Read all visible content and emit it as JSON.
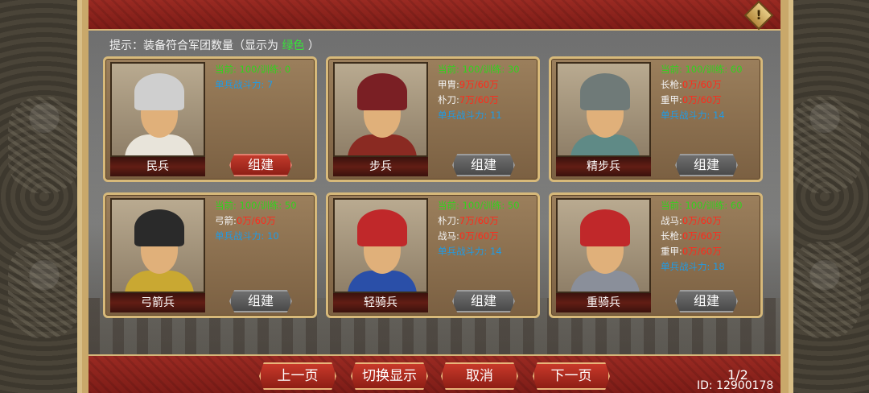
{
  "hint": {
    "prefix": "提示：装备符合军团数量（显示为",
    "green_word": "绿色",
    "suffix": "）"
  },
  "units": [
    {
      "name": "民兵",
      "stats": [
        {
          "text": "当前: 100/训练: 0",
          "color": "green"
        },
        {
          "text": "单兵战斗力: 7",
          "color": "blue"
        }
      ],
      "build_label": "组建",
      "build_active": true,
      "helm_color": "#cfcfcf",
      "body_color": "#e8e4da"
    },
    {
      "name": "步兵",
      "stats": [
        {
          "text": "当前: 100/训练: 30",
          "color": "green"
        },
        {
          "label": "甲胄:",
          "value": "9万/60万"
        },
        {
          "label": "朴刀:",
          "value": "7万/60万"
        },
        {
          "text": "单兵战斗力: 11",
          "color": "blue"
        }
      ],
      "build_label": "组建",
      "build_active": false,
      "helm_color": "#7a1f24",
      "body_color": "#8a2a22"
    },
    {
      "name": "精步兵",
      "stats": [
        {
          "text": "当前: 100/训练: 60",
          "color": "green"
        },
        {
          "label": "长枪:",
          "value": "0万/60万"
        },
        {
          "label": "重甲:",
          "value": "0万/60万"
        },
        {
          "text": "单兵战斗力: 14",
          "color": "blue"
        }
      ],
      "build_label": "组建",
      "build_active": false,
      "helm_color": "#6f7a78",
      "body_color": "#5f8a86"
    },
    {
      "name": "弓箭兵",
      "stats": [
        {
          "text": "当前: 100/训练: 50",
          "color": "green"
        },
        {
          "label": "弓箭:",
          "value": "0万/60万"
        },
        {
          "text": "单兵战斗力: 10",
          "color": "blue"
        }
      ],
      "build_label": "组建",
      "build_active": false,
      "helm_color": "#2a2a2a",
      "body_color": "#c9a832"
    },
    {
      "name": "轻骑兵",
      "stats": [
        {
          "text": "当前: 100/训练: 50",
          "color": "green"
        },
        {
          "label": "朴刀:",
          "value": "7万/60万"
        },
        {
          "label": "战马:",
          "value": "0万/60万"
        },
        {
          "text": "单兵战斗力: 14",
          "color": "blue"
        }
      ],
      "build_label": "组建",
      "build_active": false,
      "helm_color": "#c0282a",
      "body_color": "#2a4fa8"
    },
    {
      "name": "重骑兵",
      "stats": [
        {
          "text": "当前: 100/训练: 60",
          "color": "green"
        },
        {
          "label": "战马:",
          "value": "0万/60万"
        },
        {
          "label": "长枪:",
          "value": "0万/60万"
        },
        {
          "label": "重甲:",
          "value": "0万/60万"
        },
        {
          "text": "单兵战斗力: 18",
          "color": "blue"
        }
      ],
      "build_label": "组建",
      "build_active": false,
      "helm_color": "#c0282a",
      "body_color": "#8a8f9a"
    }
  ],
  "nav": {
    "prev": "上一页",
    "toggle": "切换显示",
    "cancel": "取消",
    "next": "下一页"
  },
  "page": "1/2",
  "player_id": "ID: 12900178",
  "warn_icon_glyph": "!",
  "colors": {
    "green": "#32d21e",
    "red": "#ff2a1c",
    "blue": "#1e9be6",
    "accent": "#8e1e15"
  }
}
